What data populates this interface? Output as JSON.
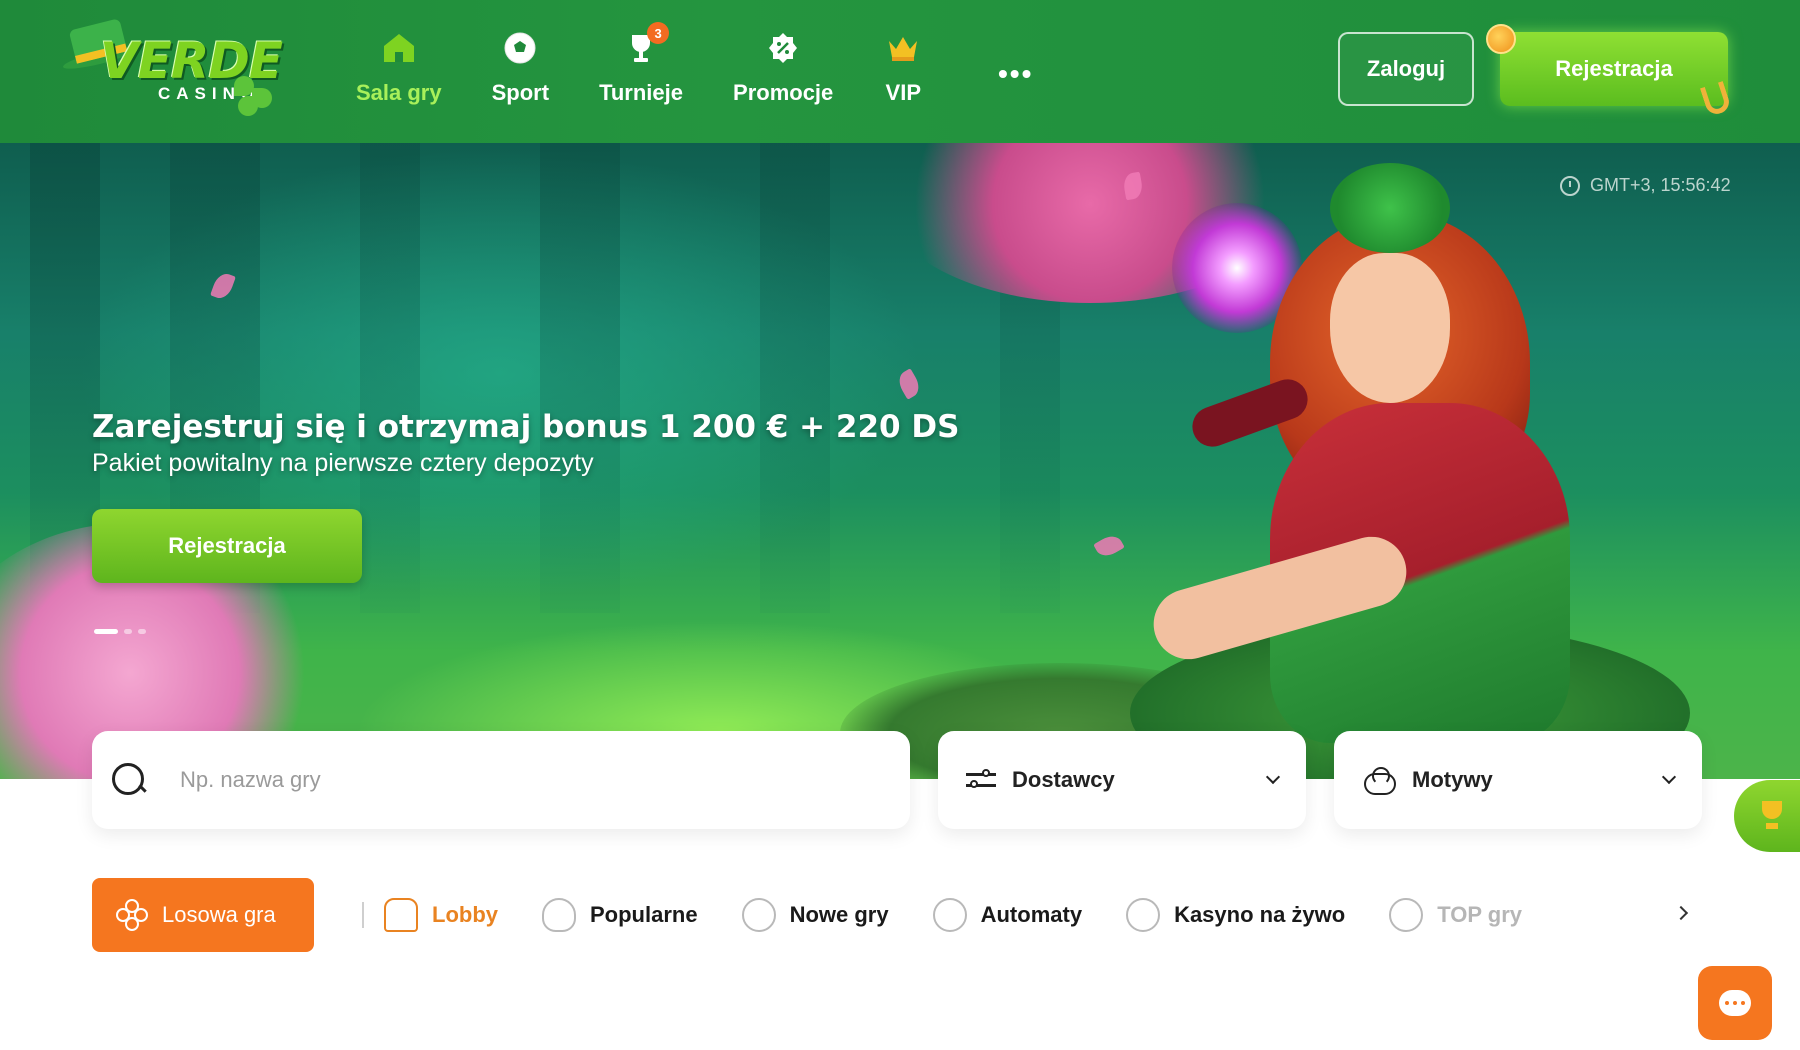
{
  "brand": {
    "name": "VERDE",
    "sub": "CASINO"
  },
  "nav": {
    "items": [
      {
        "label": "Sala gry",
        "icon": "home-icon",
        "active": true
      },
      {
        "label": "Sport",
        "icon": "soccer-ball-icon"
      },
      {
        "label": "Turnieje",
        "icon": "trophy-icon",
        "badge": "3"
      },
      {
        "label": "Promocje",
        "icon": "percent-badge-icon"
      },
      {
        "label": "VIP",
        "icon": "crown-icon"
      }
    ],
    "more": "•••"
  },
  "auth": {
    "login_label": "Zaloguj",
    "register_label": "Rejestracja"
  },
  "hero": {
    "time": "GMT+3, 15:56:42",
    "title": "Zarejestruj się i otrzymaj bonus 1 200 € + 220 DS",
    "subtitle": "Pakiet powitalny na pierwsze cztery depozyty",
    "cta_label": "Rejestracja",
    "slides": 3,
    "active_slide": 1
  },
  "search": {
    "placeholder": "Np. nazwa gry"
  },
  "filters": {
    "providers_label": "Dostawcy",
    "themes_label": "Motywy"
  },
  "categories": {
    "random_label": "Losowa gra",
    "items": [
      {
        "label": "Lobby",
        "icon": "house-icon",
        "active": true
      },
      {
        "label": "Popularne",
        "icon": "heart-icon"
      },
      {
        "label": "Nowe gry",
        "icon": "new-badge-icon"
      },
      {
        "label": "Automaty",
        "icon": "slot-machine-icon"
      },
      {
        "label": "Kasyno na żywo",
        "icon": "live-icon"
      },
      {
        "label": "TOP gry",
        "icon": "podium-icon",
        "faded": true
      }
    ]
  },
  "colors": {
    "header_green": "#1f8a3a",
    "accent_green": "#7ed321",
    "accent_orange": "#f5761f",
    "active_nav": "#a8f05a"
  }
}
